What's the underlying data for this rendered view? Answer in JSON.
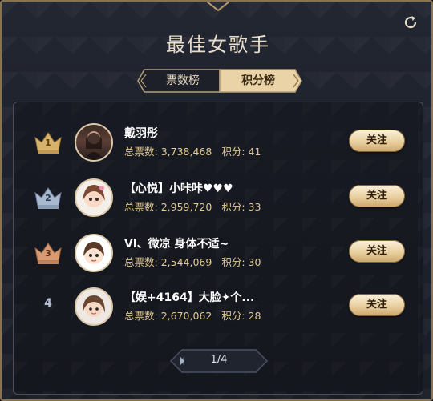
{
  "title": "最佳女歌手",
  "tabs": [
    {
      "label": "票数榜",
      "active": false
    },
    {
      "label": "积分榜",
      "active": true
    }
  ],
  "rows": [
    {
      "rank": "1",
      "name": "戴羽彤",
      "votes_label": "总票数:",
      "votes": "3,738,468",
      "points_label": "积分:",
      "points": "41",
      "follow": "关注",
      "medal": "gold"
    },
    {
      "rank": "2",
      "name": "【心悦】小咔咔♥♥♥",
      "votes_label": "总票数:",
      "votes": "2,959,720",
      "points_label": "积分:",
      "points": "33",
      "follow": "关注",
      "medal": "silver"
    },
    {
      "rank": "3",
      "name": "Vl、微凉 身体不适~",
      "votes_label": "总票数:",
      "votes": "2,544,069",
      "points_label": "积分:",
      "points": "30",
      "follow": "关注",
      "medal": "bronze"
    },
    {
      "rank": "4",
      "name": "【娱+4164】大脸✦个...",
      "votes_label": "总票数:",
      "votes": "2,670,062",
      "points_label": "积分:",
      "points": "28",
      "follow": "关注",
      "medal": "none"
    }
  ],
  "pagination": {
    "text": "1/4"
  },
  "colors": {
    "gold": "#d8b36a",
    "silver": "#a9b9d0",
    "bronze": "#d79a72",
    "accent": "#e2c98f"
  }
}
